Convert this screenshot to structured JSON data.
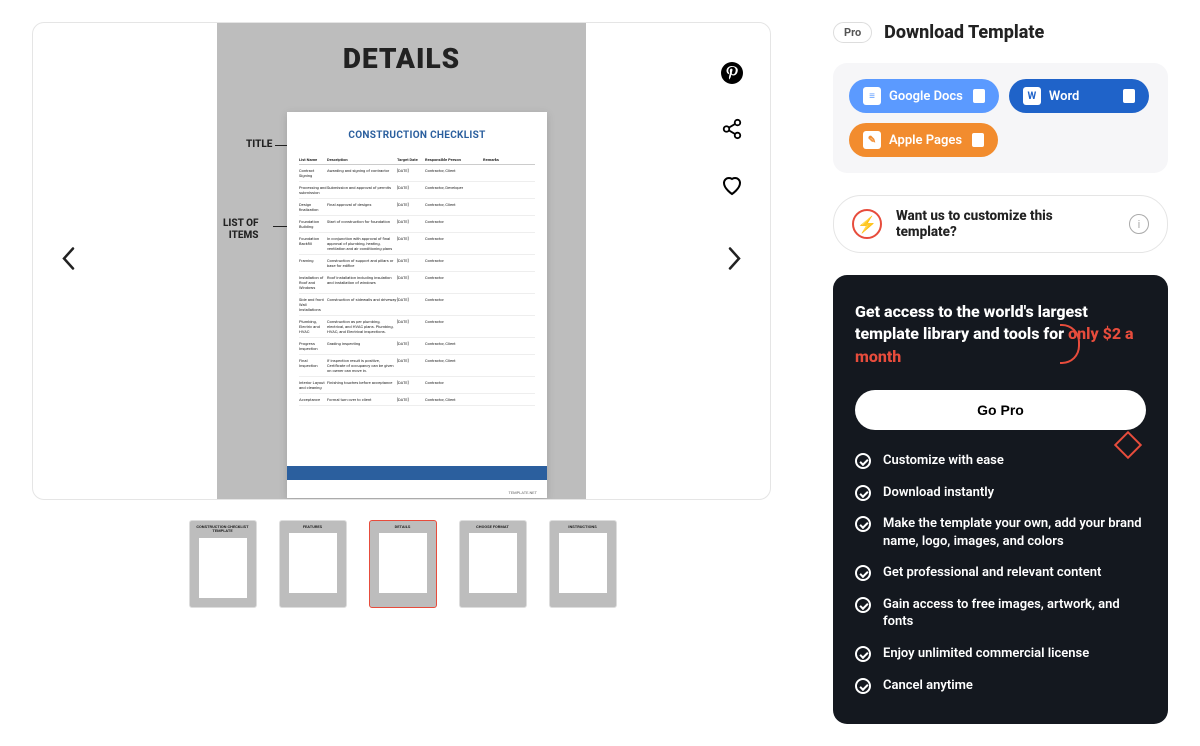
{
  "preview": {
    "details_header": "DETAILS",
    "doc_title": "CONSTRUCTION CHECKLIST",
    "label_title": "TITLE",
    "label_list": "LIST OF\nITEMS",
    "template_net": "TEMPLATE.NET",
    "headers": {
      "c1": "List Name",
      "c2": "Description",
      "c3": "Target Date",
      "c4": "Responsible Person",
      "c5": "Remarks"
    },
    "rows": [
      {
        "c1": "Contract Signing",
        "c2": "Awarding and signing of contractor",
        "c3": "[DATE]",
        "c4": "Contractor, Client"
      },
      {
        "c1": "Processing and submission",
        "c2": "Submission and approval of permits",
        "c3": "[DATE]",
        "c4": "Contractor, Developer"
      },
      {
        "c1": "Design finalization",
        "c2": "Final approval of designs",
        "c3": "[DATE]",
        "c4": "Contractor, Client"
      },
      {
        "c1": "Foundation Building",
        "c2": "Start of construction for foundation",
        "c3": "[DATE]",
        "c4": "Contractor"
      },
      {
        "c1": "Foundation Backfill",
        "c2": "In conjunction with approval of final approval of plumbing, heating, ventilation and air conditioning plans",
        "c3": "[DATE]",
        "c4": "Contractor"
      },
      {
        "c1": "Framing",
        "c2": "Construction of support and pillars or base for edifice",
        "c3": "[DATE]",
        "c4": "Contractor"
      },
      {
        "c1": "Installation of Roof and Windows",
        "c2": "Roof installation including insulation and installation of windows",
        "c3": "[DATE]",
        "c4": "Contractor"
      },
      {
        "c1": "Side and front Wall Installations",
        "c2": "Construction of sidewalls and driveway",
        "c3": "[DATE]",
        "c4": "Contractor"
      },
      {
        "c1": "Plumbing, Electric and HVAC",
        "c2": "Construction as per plumbing, electrical, and HVAC plans. Plumbing, HVAC, and Electrical inspections.",
        "c3": "[DATE]",
        "c4": "Contractor"
      },
      {
        "c1": "Progress Inspection",
        "c2": "Grading inspecting",
        "c3": "[DATE]",
        "c4": "Contractor, Client"
      },
      {
        "c1": "Final Inspection",
        "c2": "If inspection result is positive, Certificate of occupancy can be given on owner can move in.",
        "c3": "[DATE]",
        "c4": "Contractor, Client"
      },
      {
        "c1": "Interior Layout and cleaning",
        "c2": "Finishing touches before acceptance",
        "c3": "[DATE]",
        "c4": "Contractor"
      },
      {
        "c1": "Acceptance",
        "c2": "Formal turn over to client",
        "c3": "[DATE]",
        "c4": "Contractor, Client"
      }
    ]
  },
  "thumbs": [
    {
      "label": "CONSTRUCTION CHECKLIST TEMPLATE"
    },
    {
      "label": "FEATURES"
    },
    {
      "label": "DETAILS"
    },
    {
      "label": "CHOOSE FORMAT"
    },
    {
      "label": "INSTRUCTIONS"
    }
  ],
  "download": {
    "pro": "Pro",
    "title": "Download Template",
    "formats": {
      "gd": "Google Docs",
      "wd": "Word",
      "ap": "Apple Pages"
    }
  },
  "customize": {
    "text": "Want us to customize this template?"
  },
  "promo": {
    "head_a": "Get access to the world's largest template library and tools for ",
    "price": "only $2 a month",
    "gopro": "Go Pro",
    "features": [
      "Customize with ease",
      "Download instantly",
      "Make the template your own, add your brand name, logo, images, and colors",
      "Get professional and relevant content",
      "Gain access to free images, artwork, and fonts",
      "Enjoy unlimited commercial license",
      "Cancel anytime"
    ]
  }
}
